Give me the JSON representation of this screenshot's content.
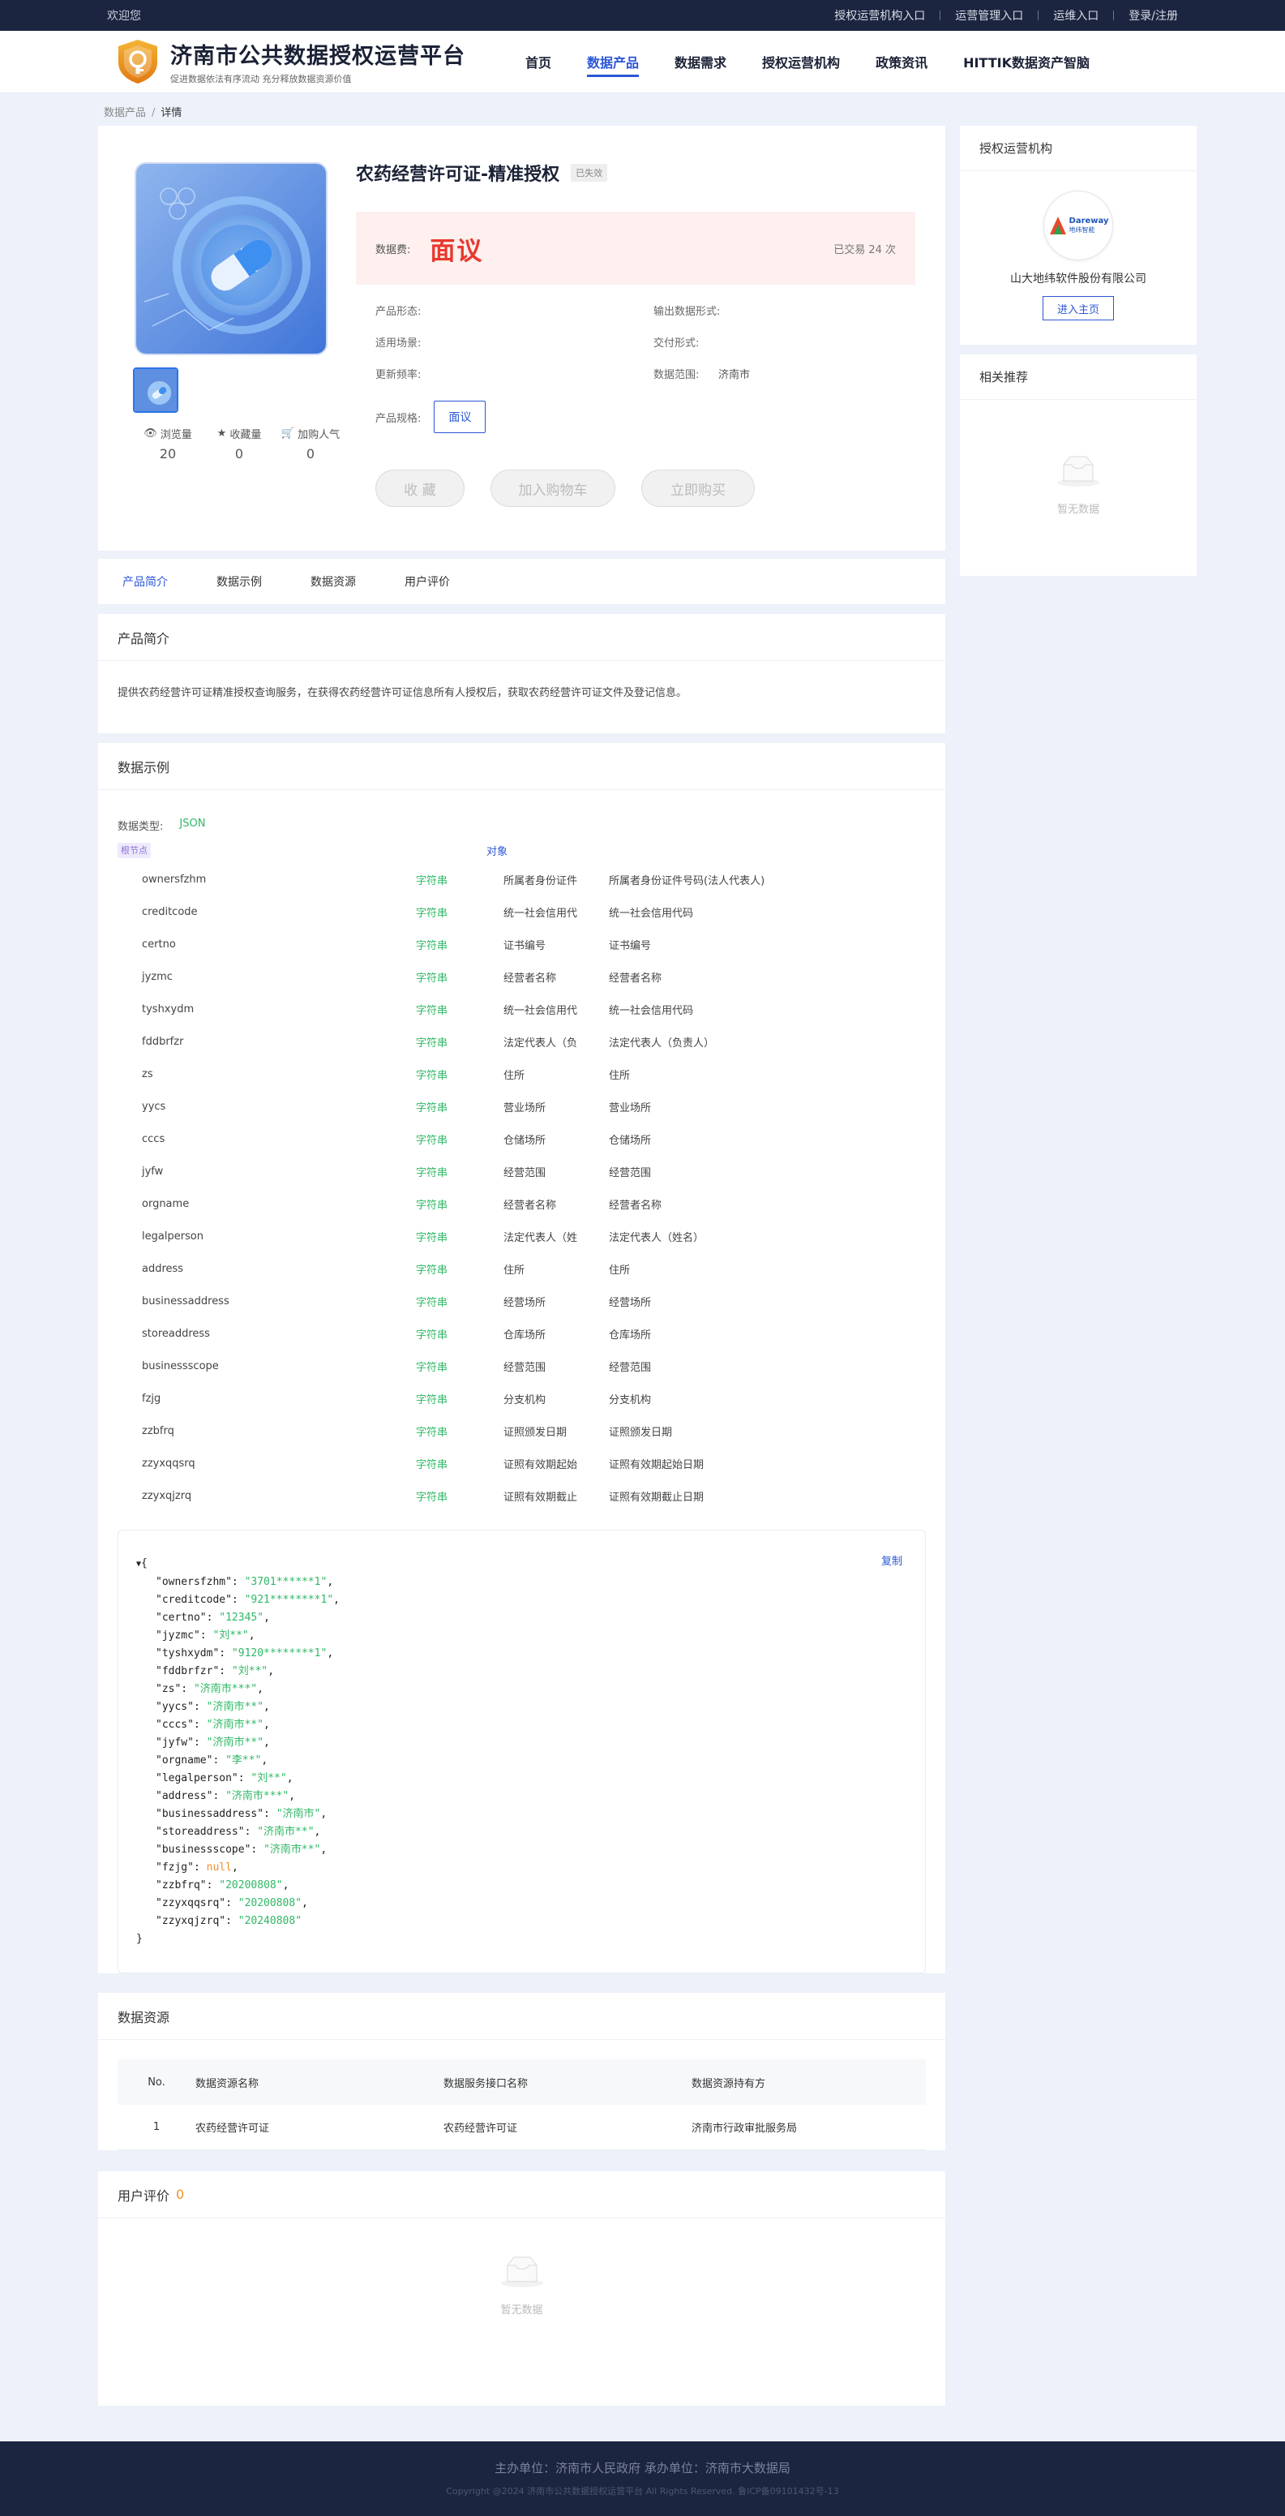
{
  "topbar": {
    "welcome": "欢迎您",
    "links": [
      "授权运营机构入口",
      "运营管理入口",
      "运维入口",
      "登录/注册"
    ]
  },
  "header": {
    "title": "济南市公共数据授权运营平台",
    "subtitle": "促进数据依法有序流动 充分释放数据资源价值",
    "nav": [
      "首页",
      "数据产品",
      "数据需求",
      "授权运营机构",
      "政策资讯",
      "HITTIK数据资产智脑"
    ],
    "active_nav": "数据产品"
  },
  "breadcrumb": {
    "parent": "数据产品",
    "sep": "/",
    "current": "详情"
  },
  "product": {
    "title": "农药经营许可证-精准授权",
    "status_badge": "已失效",
    "price_label": "数据费:",
    "price_value": "面议",
    "trade_count": "已交易 24 次",
    "specs": {
      "form_label": "产品形态:",
      "form_value": "",
      "output_label": "输出数据形式:",
      "output_value": "",
      "scene_label": "适用场景:",
      "scene_value": "",
      "delivery_label": "交付形式:",
      "delivery_value": "",
      "freq_label": "更新频率:",
      "freq_value": "",
      "range_label": "数据范围:",
      "range_value": "济南市",
      "spec_label": "产品规格:",
      "spec_option": "面议"
    },
    "stats": [
      {
        "label": "浏览量",
        "value": "20",
        "icon": "eye-icon"
      },
      {
        "label": "收藏量",
        "value": "0",
        "icon": "star-icon"
      },
      {
        "label": "加购人气",
        "value": "0",
        "icon": "cart-icon"
      }
    ],
    "actions": {
      "collect": "收 藏",
      "add_cart": "加入购物车",
      "buy": "立即购买"
    }
  },
  "tabs": [
    "产品简介",
    "数据示例",
    "数据资源",
    "用户评价"
  ],
  "intro": {
    "title": "产品简介",
    "text": "提供农药经营许可证精准授权查询服务，在获得农药经营许可证信息所有人授权后，获取农药经营许可证文件及登记信息。"
  },
  "sample": {
    "title": "数据示例",
    "type_label": "数据类型:",
    "type_value": "JSON",
    "root_label": "根节点",
    "root_type": "对象",
    "fields": [
      [
        "ownersfzhm",
        "字符串",
        "所属者身份证件",
        "所属者身份证件号码(法人代表人)"
      ],
      [
        "creditcode",
        "字符串",
        "统一社会信用代",
        "统一社会信用代码"
      ],
      [
        "certno",
        "字符串",
        "证书编号",
        "证书编号"
      ],
      [
        "jyzmc",
        "字符串",
        "经营者名称",
        "经营者名称"
      ],
      [
        "tyshxydm",
        "字符串",
        "统一社会信用代",
        "统一社会信用代码"
      ],
      [
        "fddbrfzr",
        "字符串",
        "法定代表人（负",
        "法定代表人（负责人）"
      ],
      [
        "zs",
        "字符串",
        "住所",
        "住所"
      ],
      [
        "yycs",
        "字符串",
        "营业场所",
        "营业场所"
      ],
      [
        "cccs",
        "字符串",
        "仓储场所",
        "仓储场所"
      ],
      [
        "jyfw",
        "字符串",
        "经营范围",
        "经营范围"
      ],
      [
        "orgname",
        "字符串",
        "经营者名称",
        "经营者名称"
      ],
      [
        "legalperson",
        "字符串",
        "法定代表人（姓",
        "法定代表人（姓名）"
      ],
      [
        "address",
        "字符串",
        "住所",
        "住所"
      ],
      [
        "businessaddress",
        "字符串",
        "经营场所",
        "经营场所"
      ],
      [
        "storeaddress",
        "字符串",
        "仓库场所",
        "仓库场所"
      ],
      [
        "businessscope",
        "字符串",
        "经营范围",
        "经营范围"
      ],
      [
        "fzjg",
        "字符串",
        "分支机构",
        "分支机构"
      ],
      [
        "zzbfrq",
        "字符串",
        "证照颁发日期",
        "证照颁发日期"
      ],
      [
        "zzyxqqsrq",
        "字符串",
        "证照有效期起始",
        "证照有效期起始日期"
      ],
      [
        "zzyxqjzrq",
        "字符串",
        "证照有效期截止",
        "证照有效期截止日期"
      ]
    ],
    "copy_label": "复制",
    "json_lines": [
      [
        "ownersfzhm",
        "\"3701******1\"",
        "s"
      ],
      [
        "creditcode",
        "\"921********1\"",
        "s"
      ],
      [
        "certno",
        "\"12345\"",
        "s"
      ],
      [
        "jyzmc",
        "\"刘**\"",
        "s"
      ],
      [
        "tyshxydm",
        "\"9120********1\"",
        "s"
      ],
      [
        "fddbrfzr",
        "\"刘**\"",
        "s"
      ],
      [
        "zs",
        "\"济南市***\"",
        "s"
      ],
      [
        "yycs",
        "\"济南市**\"",
        "s"
      ],
      [
        "cccs",
        "\"济南市**\"",
        "s"
      ],
      [
        "jyfw",
        "\"济南市**\"",
        "s"
      ],
      [
        "orgname",
        "\"李**\"",
        "s"
      ],
      [
        "legalperson",
        "\"刘**\"",
        "s"
      ],
      [
        "address",
        "\"济南市***\"",
        "s"
      ],
      [
        "businessaddress",
        "\"济南市\"",
        "s"
      ],
      [
        "storeaddress",
        "\"济南市**\"",
        "s"
      ],
      [
        "businessscope",
        "\"济南市**\"",
        "s"
      ],
      [
        "fzjg",
        "null",
        "n"
      ],
      [
        "zzbfrq",
        "\"20200808\"",
        "s"
      ],
      [
        "zzyxqqsrq",
        "\"20200808\"",
        "s"
      ],
      [
        "zzyxqjzrq",
        "\"20240808\"",
        "s"
      ]
    ]
  },
  "resources": {
    "title": "数据资源",
    "headers": [
      "No.",
      "数据资源名称",
      "数据服务接口名称",
      "数据资源持有方"
    ],
    "rows": [
      [
        "1",
        "农药经营许可证",
        "农药经营许可证",
        "济南市行政审批服务局"
      ]
    ]
  },
  "reviews": {
    "title": "用户评价",
    "count": "0",
    "empty": "暂无数据"
  },
  "side": {
    "org_title": "授权运营机构",
    "org_logo_text": "Dareway",
    "org_logo_sub": "地纬智能",
    "org_name": "山大地纬软件股份有限公司",
    "org_button": "进入主页",
    "rec_title": "相关推荐",
    "rec_empty": "暂无数据"
  },
  "footer": {
    "line1": "主办单位：济南市人民政府    承办单位：济南市大数据局",
    "line2": "Copyright @2024 济南市公共数据授权运营平台 All Rights Reserved. 鲁ICP备09101432号-13"
  },
  "colors": {
    "primary": "#2b56d6",
    "price": "#e8392e",
    "string_type": "#2fb866",
    "dark": "#1c2540"
  }
}
